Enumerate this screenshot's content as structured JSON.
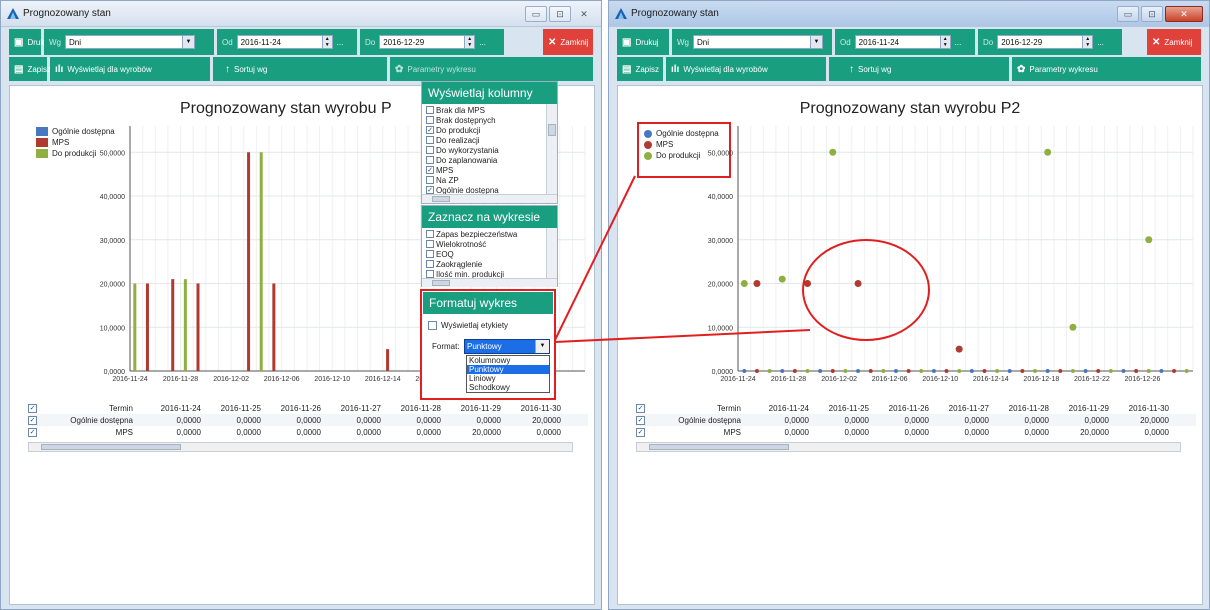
{
  "window_title": "Prognozowany stan",
  "window_buttons": {
    "minimize": "▭",
    "maximize": "⊡",
    "close": "✕"
  },
  "toolbar": {
    "print_label": "Drukuj",
    "group_by_label": "Wg",
    "group_by_value": "Dni",
    "from_label": "Od",
    "from_value": "2016-11-24",
    "to_label": "Do",
    "to_value": "2016-12-29",
    "ellipsis": "...",
    "close_label": "Zamknij",
    "save_label": "Zapisz",
    "show_for_products_label": "Wyświetlaj dla wyrobów",
    "sort_label": "Sortuj wg",
    "chart_params_label": "Parametry wykresu"
  },
  "colors": {
    "accent": "#1a9e80",
    "close": "#e0413a",
    "blue": "#4a78c0",
    "red": "#b03a30",
    "green": "#8fb040",
    "highlight": "#e02020"
  },
  "legend": [
    "Ogólnie dostępna",
    "MPS",
    "Do produkcji"
  ],
  "left_chart_title": "Prognozowany stan wyrobu P",
  "right_chart_title": "Prognozowany stan wyrobu P2",
  "chart_data": [
    {
      "type": "bar",
      "title": "Prognozowany stan wyrobu P",
      "y_ticks": [
        "0,0000",
        "10,0000",
        "20,0000",
        "30,0000",
        "40,0000",
        "50,0000"
      ],
      "ylim": [
        0,
        56
      ],
      "x_ticks": [
        "2016-11-24",
        "2016-11-28",
        "2016-12-02",
        "2016-12-06",
        "2016-12-10",
        "2016-12-14",
        "2016-12-18"
      ],
      "series": [
        {
          "name": "Ogólnie dostępna",
          "points": []
        },
        {
          "name": "MPS",
          "points": [
            [
              1,
              20
            ],
            [
              3,
              21
            ],
            [
              5,
              20
            ],
            [
              9,
              50
            ],
            [
              11,
              20
            ],
            [
              20,
              5
            ]
          ]
        },
        {
          "name": "Do produkcji",
          "points": [
            [
              0,
              20
            ],
            [
              4,
              21
            ],
            [
              10,
              50
            ]
          ]
        }
      ]
    },
    {
      "type": "scatter",
      "title": "Prognozowany stan wyrobu P2",
      "y_ticks": [
        "0,0000",
        "10,0000",
        "20,0000",
        "30,0000",
        "40,0000",
        "50,0000"
      ],
      "ylim": [
        0,
        56
      ],
      "x_ticks": [
        "2016-11-24",
        "2016-11-28",
        "2016-12-02",
        "2016-12-06",
        "2016-12-10",
        "2016-12-14",
        "2016-12-18",
        "2016-12-22",
        "2016-12-26"
      ],
      "series": [
        {
          "name": "Ogólnie dostępna",
          "points": []
        },
        {
          "name": "MPS",
          "points": [
            [
              1,
              20
            ],
            [
              5,
              20
            ],
            [
              9,
              20
            ],
            [
              17,
              5
            ]
          ]
        },
        {
          "name": "Do produkcji",
          "points": [
            [
              0,
              20
            ],
            [
              3,
              21
            ],
            [
              7,
              50
            ],
            [
              24,
              50
            ],
            [
              26,
              10
            ],
            [
              32,
              30
            ]
          ]
        }
      ]
    }
  ],
  "table": {
    "header_label": "Termin",
    "dates": [
      "2016-11-24",
      "2016-11-25",
      "2016-11-26",
      "2016-11-27",
      "2016-11-28",
      "2016-11-29",
      "2016-11-30"
    ],
    "rows": [
      {
        "label": "Ogólnie dostępna",
        "values": [
          "0,0000",
          "0,0000",
          "0,0000",
          "0,0000",
          "0,0000",
          "0,0000",
          "20,0000"
        ]
      },
      {
        "label": "MPS",
        "values": [
          "0,0000",
          "0,0000",
          "0,0000",
          "0,0000",
          "0,0000",
          "20,0000",
          "0,0000"
        ]
      }
    ],
    "scroll_marker": "III"
  },
  "panel_columns": {
    "title": "Wyświetlaj kolumny",
    "items": [
      {
        "label": "Brak dla MPS",
        "checked": false
      },
      {
        "label": "Brak dostępnych",
        "checked": false
      },
      {
        "label": "Do produkcji",
        "checked": true
      },
      {
        "label": "Do realizacji",
        "checked": false
      },
      {
        "label": "Do wykorzystania",
        "checked": false
      },
      {
        "label": "Do zaplanowania",
        "checked": false
      },
      {
        "label": "MPS",
        "checked": true
      },
      {
        "label": "Na ZP",
        "checked": false
      },
      {
        "label": "Ogólnie dostępna",
        "checked": true
      }
    ]
  },
  "panel_mark": {
    "title": "Zaznacz na wykresie",
    "items": [
      "Zapas bezpieczeństwa",
      "Wielokrotność",
      "EOQ",
      "Zaokrąglenie",
      "Ilość min. produkcji"
    ]
  },
  "panel_format": {
    "title": "Formatuj wykres",
    "show_labels": "Wyświetlaj etykiety",
    "format_label": "Format:",
    "format_value": "Punktowy",
    "options": [
      "Kolumnowy",
      "Punktowy",
      "Liniowy",
      "Schodkowy"
    ],
    "selected_index": 1
  }
}
